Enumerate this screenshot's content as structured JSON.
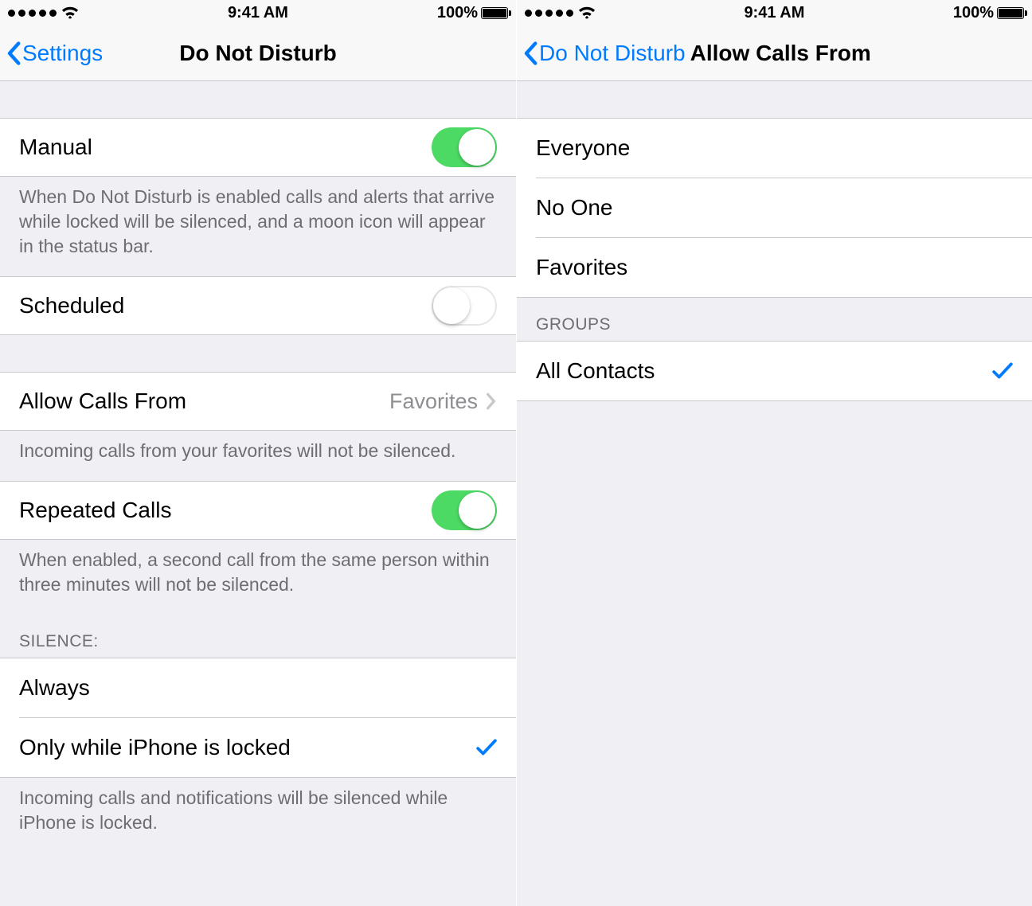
{
  "status": {
    "time": "9:41 AM",
    "battery_pct": "100%"
  },
  "left": {
    "back_label": "Settings",
    "title": "Do Not Disturb",
    "manual": {
      "label": "Manual",
      "on": true
    },
    "manual_footer": "When Do Not Disturb is enabled calls and alerts that arrive while locked will be silenced, and a moon icon will appear in the status bar.",
    "scheduled": {
      "label": "Scheduled",
      "on": false
    },
    "allow_calls": {
      "label": "Allow Calls From",
      "value": "Favorites"
    },
    "allow_calls_footer": "Incoming calls from your favorites will not be silenced.",
    "repeated": {
      "label": "Repeated Calls",
      "on": true
    },
    "repeated_footer": "When enabled, a second call from the same person within three minutes will not be silenced.",
    "silence_header": "SILENCE:",
    "silence_options": [
      {
        "label": "Always",
        "checked": false
      },
      {
        "label": "Only while iPhone is locked",
        "checked": true
      }
    ],
    "silence_footer": "Incoming calls and notifications will be silenced while iPhone is locked."
  },
  "right": {
    "back_label": "Do Not Disturb",
    "title": "Allow Calls From",
    "options": [
      {
        "label": "Everyone",
        "checked": false
      },
      {
        "label": "No One",
        "checked": false
      },
      {
        "label": "Favorites",
        "checked": false
      }
    ],
    "groups_header": "GROUPS",
    "groups": [
      {
        "label": "All Contacts",
        "checked": true
      }
    ]
  }
}
